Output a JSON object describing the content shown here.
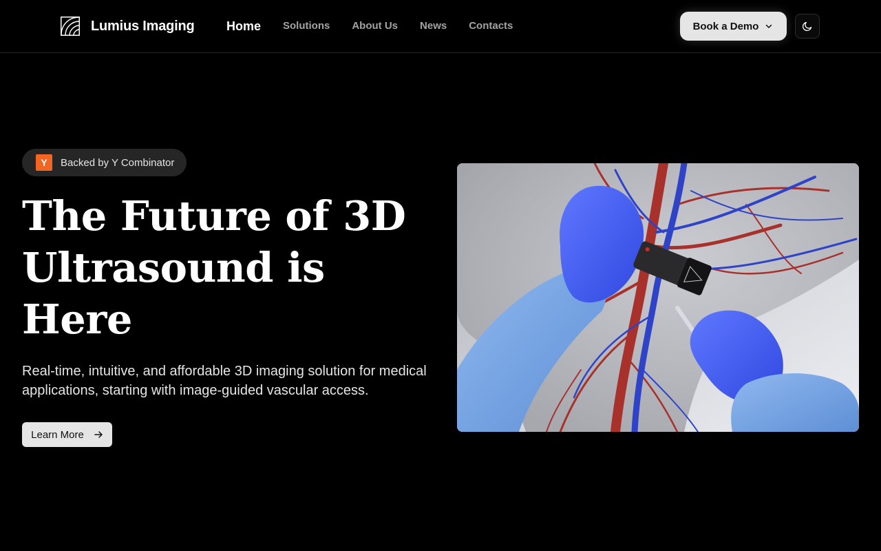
{
  "header": {
    "brand": "Lumius Imaging",
    "logo_icon": "lumius-logo-icon",
    "nav": [
      {
        "label": "Home",
        "active": true
      },
      {
        "label": "Solutions",
        "active": false
      },
      {
        "label": "About Us",
        "active": false
      },
      {
        "label": "News",
        "active": false
      },
      {
        "label": "Contacts",
        "active": false
      }
    ],
    "demo_button": "Book a Demo",
    "demo_icon": "chevron-down-icon",
    "theme_icon": "moon-icon"
  },
  "hero": {
    "badge": {
      "logo": "Y",
      "text": "Backed by Y Combinator",
      "logo_color": "#f26522"
    },
    "title": "The Future of 3D Ultrasound is Here",
    "subtitle": "Real-time, intuitive, and affordable 3D imaging solution for medical applications, starting with image-guided vascular access.",
    "cta": "Learn More",
    "cta_icon": "arrow-right-icon",
    "image": "3d-ultrasound-vascular-illustration"
  },
  "colors": {
    "background": "#000000",
    "text": "#ffffff",
    "muted_text": "#a3a3a3",
    "button_bg": "#e5e5e5",
    "yc_orange": "#f26522"
  }
}
